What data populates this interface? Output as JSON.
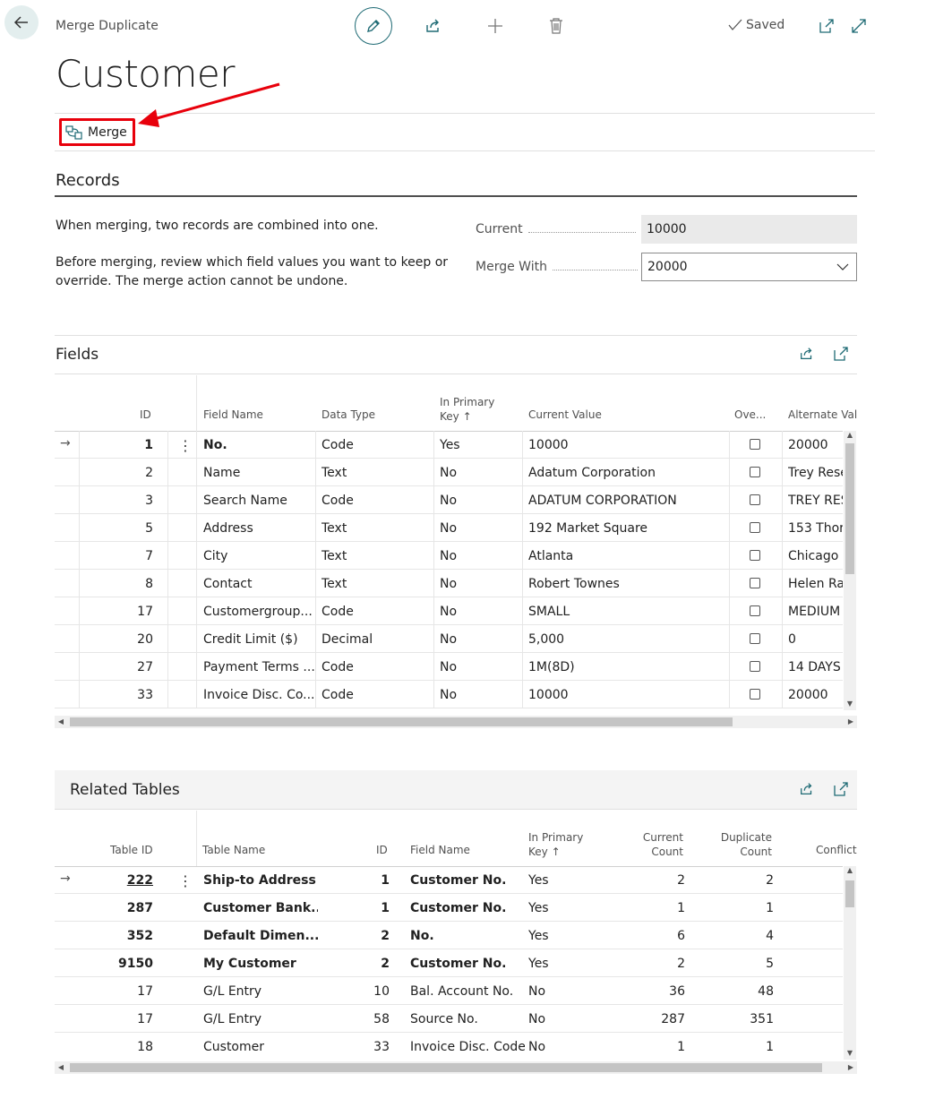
{
  "header": {
    "caption": "Merge Duplicate",
    "title": "Customer",
    "saved_label": "Saved"
  },
  "action_bar": {
    "merge_label": "Merge"
  },
  "records": {
    "title": "Records",
    "description_1": "When merging, two records are combined into one.",
    "description_2_line1": "Before merging, review which field values you want to keep or",
    "description_2_line2": "override. The merge action cannot be undone.",
    "current_label": "Current",
    "current_value": "10000",
    "merge_with_label": "Merge With",
    "merge_with_value": "20000"
  },
  "fields": {
    "title": "Fields",
    "columns": {
      "id": "ID",
      "field_name": "Field Name",
      "data_type": "Data Type",
      "in_primary_key_1": "In Primary",
      "in_primary_key_2": "Key ↑",
      "current_value": "Current Value",
      "override": "Ove...",
      "alternate_value": "Alternate Valu"
    },
    "rows": [
      {
        "id": "1",
        "name": "No.",
        "type": "Code",
        "pk": "Yes",
        "current": "10000",
        "alt": "20000"
      },
      {
        "id": "2",
        "name": "Name",
        "type": "Text",
        "pk": "No",
        "current": "Adatum Corporation",
        "alt": "Trey Rese"
      },
      {
        "id": "3",
        "name": "Search Name",
        "type": "Code",
        "pk": "No",
        "current": "ADATUM CORPORATION",
        "alt": "TREY RES"
      },
      {
        "id": "5",
        "name": "Address",
        "type": "Text",
        "pk": "No",
        "current": "192 Market Square",
        "alt": "153 Thor"
      },
      {
        "id": "7",
        "name": "City",
        "type": "Text",
        "pk": "No",
        "current": "Atlanta",
        "alt": "Chicago"
      },
      {
        "id": "8",
        "name": "Contact",
        "type": "Text",
        "pk": "No",
        "current": "Robert Townes",
        "alt": "Helen Ra"
      },
      {
        "id": "17",
        "name": "Customergroup...",
        "type": "Code",
        "pk": "No",
        "current": "SMALL",
        "alt": "MEDIUM"
      },
      {
        "id": "20",
        "name": "Credit Limit ($)",
        "type": "Decimal",
        "pk": "No",
        "current": "5,000",
        "alt": "0"
      },
      {
        "id": "27",
        "name": "Payment Terms ...",
        "type": "Code",
        "pk": "No",
        "current": "1M(8D)",
        "alt": "14 DAYS"
      },
      {
        "id": "33",
        "name": "Invoice Disc. Co...",
        "type": "Code",
        "pk": "No",
        "current": "10000",
        "alt": "20000"
      }
    ]
  },
  "related": {
    "title": "Related Tables",
    "columns": {
      "table_id": "Table ID",
      "table_name": "Table Name",
      "id": "ID",
      "field_name": "Field Name",
      "in_primary_key_1": "In Primary",
      "in_primary_key_2": "Key ↑",
      "current_count_1": "Current",
      "current_count_2": "Count",
      "duplicate_count_1": "Duplicate",
      "duplicate_count_2": "Count",
      "conflicts": "Conflicts"
    },
    "rows": [
      {
        "table_id": "222",
        "table_name": "Ship-to Address",
        "id": "1",
        "field": "Customer No.",
        "pk": "Yes",
        "current": "2",
        "dup": "2"
      },
      {
        "table_id": "287",
        "table_name": "Customer Bank...",
        "id": "1",
        "field": "Customer No.",
        "pk": "Yes",
        "current": "1",
        "dup": "1"
      },
      {
        "table_id": "352",
        "table_name": "Default Dimen...",
        "id": "2",
        "field": "No.",
        "pk": "Yes",
        "current": "6",
        "dup": "4"
      },
      {
        "table_id": "9150",
        "table_name": "My Customer",
        "id": "2",
        "field": "Customer No.",
        "pk": "Yes",
        "current": "2",
        "dup": "5"
      },
      {
        "table_id": "17",
        "table_name": "G/L Entry",
        "id": "10",
        "field": "Bal. Account No.",
        "pk": "No",
        "current": "36",
        "dup": "48"
      },
      {
        "table_id": "17",
        "table_name": "G/L Entry",
        "id": "58",
        "field": "Source No.",
        "pk": "No",
        "current": "287",
        "dup": "351"
      },
      {
        "table_id": "18",
        "table_name": "Customer",
        "id": "33",
        "field": "Invoice Disc. Code",
        "pk": "No",
        "current": "1",
        "dup": "1"
      }
    ]
  },
  "colors": {
    "accent": "#1e6a74",
    "highlight": "#e8000b"
  }
}
